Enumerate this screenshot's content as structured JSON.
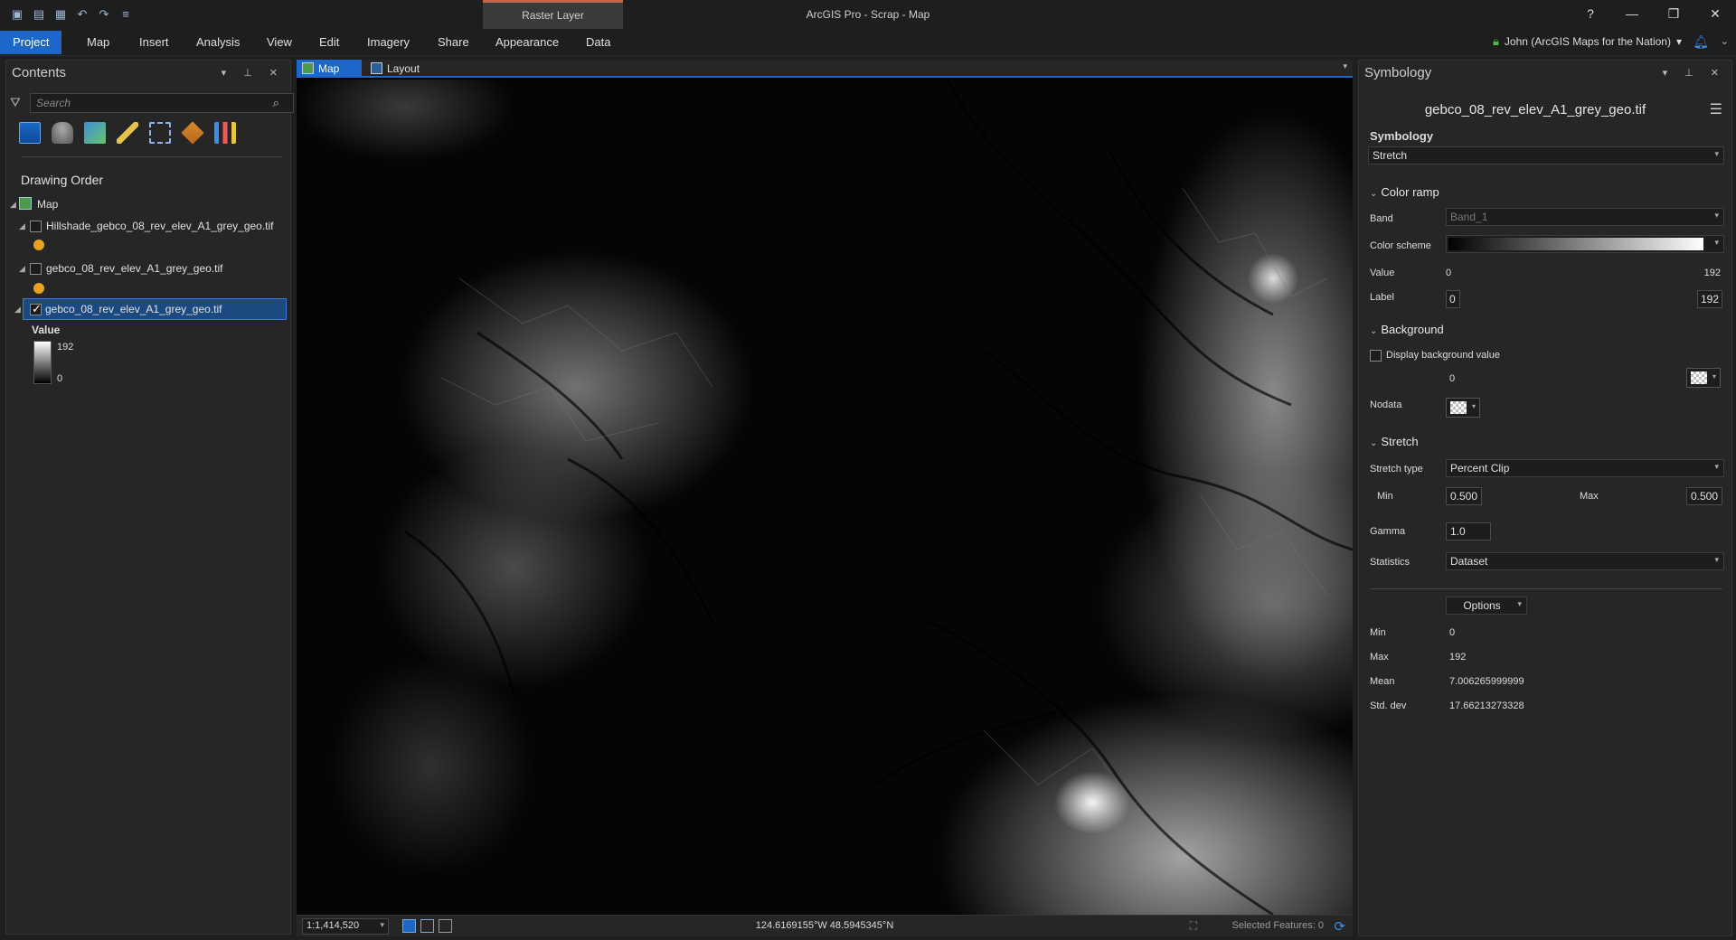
{
  "app": {
    "title": "ArcGIS Pro - Scrap - Map",
    "context_tab": "Raster Layer",
    "help": "?",
    "minimize": "—",
    "restore": "❐",
    "close": "✕",
    "user": "John (ArcGIS Maps for the Nation)"
  },
  "ribbon": {
    "tabs": [
      "Project",
      "Map",
      "Insert",
      "Analysis",
      "View",
      "Edit",
      "Imagery",
      "Share",
      "Appearance",
      "Data"
    ]
  },
  "contents": {
    "title": "Contents",
    "search_placeholder": "Search",
    "drawing_order": "Drawing Order",
    "map_label": "Map",
    "layers": [
      {
        "name": "Hillshade_gebco_08_rev_elev_A1_grey_geo.tif",
        "checked": false
      },
      {
        "name": "gebco_08_rev_elev_A1_grey_geo.tif",
        "checked": false
      },
      {
        "name": "gebco_08_rev_elev_A1_grey_geo.tif",
        "checked": true
      }
    ],
    "legend": {
      "title": "Value",
      "high": "192",
      "low": "0"
    }
  },
  "mapview": {
    "tabs": [
      "Map",
      "Layout"
    ],
    "scale": "1:1,414,520",
    "coordinates": "124.6169155°W 48.5945345°N",
    "selected_features": "Selected Features: 0"
  },
  "symbology": {
    "title": "Symbology",
    "layer_name": "gebco_08_rev_elev_A1_grey_geo.tif",
    "renderer_label": "Symbology",
    "renderer": "Stretch",
    "color_ramp_section": "Color ramp",
    "band_label": "Band",
    "band": "Band_1",
    "color_scheme_label": "Color scheme",
    "value_label": "Value",
    "value_min": "0",
    "value_max": "192",
    "label_label": "Label",
    "label_min": "0",
    "label_max": "192",
    "background_section": "Background",
    "display_background": "Display background value",
    "background_value": "0",
    "nodata_label": "Nodata",
    "stretch_section": "Stretch",
    "stretch_type_label": "Stretch type",
    "stretch_type": "Percent Clip",
    "min_label": "Min",
    "min_value": "0.500",
    "max_label": "Max",
    "max_value": "0.500",
    "gamma_label": "Gamma",
    "gamma": "1.0",
    "statistics_label": "Statistics",
    "statistics": "Dataset",
    "options_button": "Options",
    "stats": {
      "min_label": "Min",
      "min": "0",
      "max_label": "Max",
      "max": "192",
      "mean_label": "Mean",
      "mean": "7.006265999999",
      "std_label": "Std. dev",
      "std": "17.66213273328"
    }
  }
}
